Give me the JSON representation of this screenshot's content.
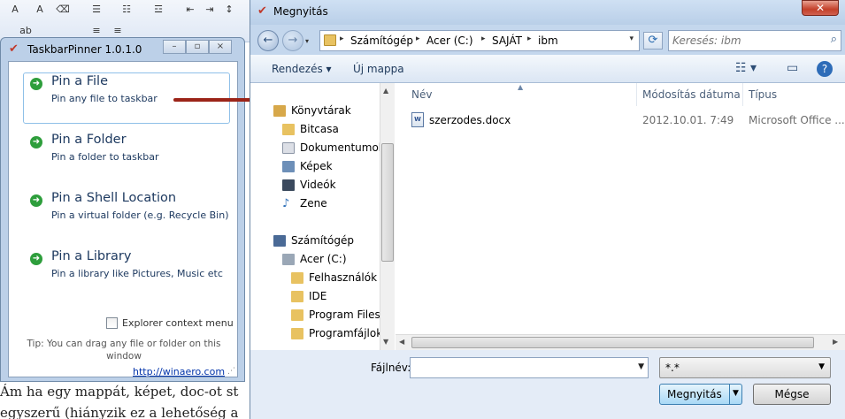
{
  "taskbarpinner": {
    "title": "TaskbarPinner 1.0.1.0",
    "items": [
      {
        "title": "Pin a File",
        "desc": "Pin any file to taskbar"
      },
      {
        "title": "Pin a Folder",
        "desc": "Pin a folder to taskbar"
      },
      {
        "title": "Pin a Shell Location",
        "desc": "Pin a virtual folder (e.g. Recycle Bin)"
      },
      {
        "title": "Pin a Library",
        "desc": "Pin a library like Pictures, Music etc"
      }
    ],
    "context_menu_label": "Explorer context menu",
    "context_menu_checked": false,
    "tip": "Tip: You can drag any file or folder on this window",
    "link": "http://winaero.com"
  },
  "background_doc": {
    "line1": "Ám ha egy mappát, képet, doc-ot st",
    "line2": "egyszerű (hiányzik ez a lehetőség a"
  },
  "dialog": {
    "title": "Megnyitás",
    "breadcrumb": [
      "Számítógép",
      "Acer (C:)",
      "SAJÁT",
      "ibm"
    ],
    "search_placeholder": "Keresés: ibm",
    "toolbar": {
      "organize": "Rendezés",
      "new_folder": "Új mappa"
    },
    "nav_items": [
      {
        "label": "Könyvtárak",
        "icon": "library-icon",
        "level": 0
      },
      {
        "label": "Bitcasa",
        "icon": "folder-icon",
        "level": 1
      },
      {
        "label": "Dokumentumok",
        "icon": "documents-icon",
        "level": 1
      },
      {
        "label": "Képek",
        "icon": "pictures-icon",
        "level": 1
      },
      {
        "label": "Videók",
        "icon": "videos-icon",
        "level": 1
      },
      {
        "label": "Zene",
        "icon": "music-icon",
        "level": 1
      },
      {
        "label": "Számítógép",
        "icon": "computer-icon",
        "level": 0
      },
      {
        "label": "Acer (C:)",
        "icon": "drive-icon",
        "level": 1
      },
      {
        "label": "Felhasználók",
        "icon": "folder-icon",
        "level": 2
      },
      {
        "label": "IDE",
        "icon": "folder-icon",
        "level": 2
      },
      {
        "label": "Program Files",
        "icon": "folder-icon",
        "level": 2
      },
      {
        "label": "Programfájlok",
        "icon": "folder-icon",
        "level": 2
      }
    ],
    "columns": [
      "Név",
      "Módosítás dátuma",
      "Típus"
    ],
    "files": [
      {
        "name": "szerzodes.docx",
        "modified": "2012.10.01. 7:49",
        "type": "Microsoft Office ..."
      }
    ],
    "filename_label": "Fájlnév:",
    "filename_value": "",
    "filter_value": "*.*",
    "open_label": "Megnyitás",
    "cancel_label": "Mégse"
  },
  "colors": {
    "accent": "#1e3a60",
    "pin_arrow": "#2e9e3c",
    "callout_arrow": "#9b2418",
    "link": "#0033aa"
  }
}
